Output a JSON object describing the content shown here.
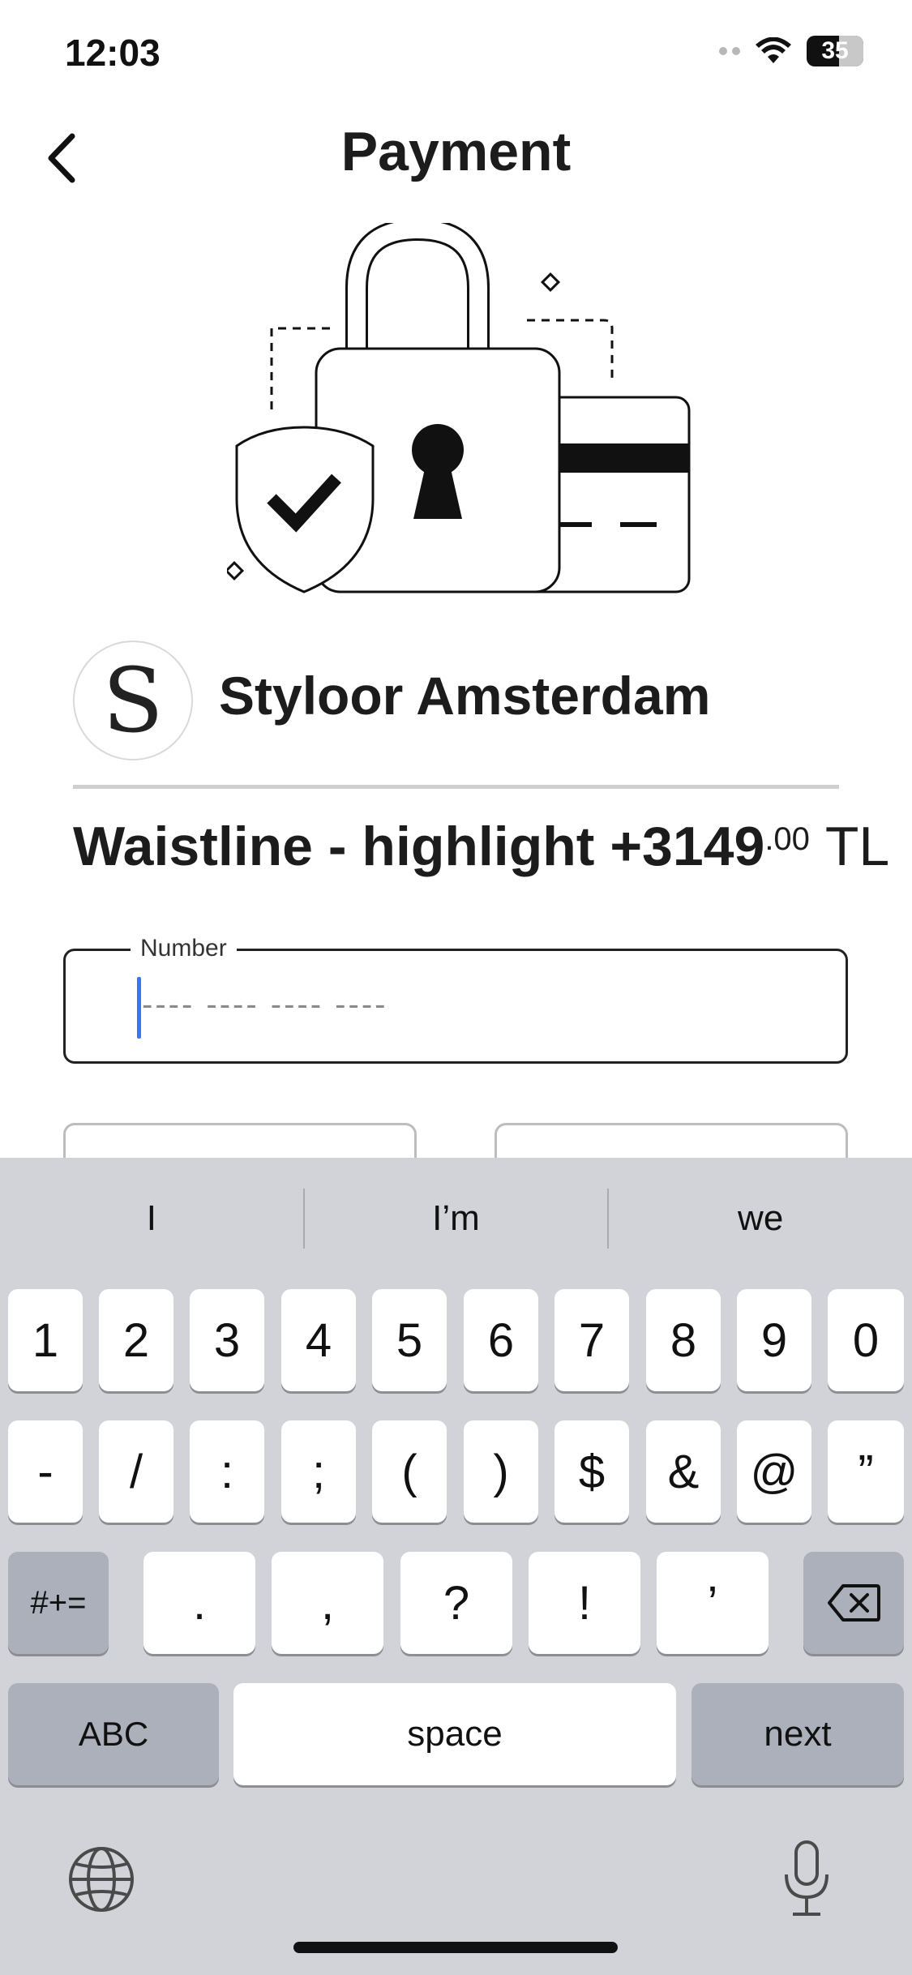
{
  "status_bar": {
    "time": "12:03",
    "battery": "35"
  },
  "header": {
    "title": "Payment"
  },
  "merchant": {
    "logo_letter": "S",
    "name": "Styloor Amsterdam"
  },
  "product": {
    "name": "Waistline - highlight",
    "price_whole": "+3149",
    "price_cents": ".00",
    "currency": "TL"
  },
  "card_form": {
    "number_label": "Number",
    "number_placeholder": "---- ---- ---- ----"
  },
  "keyboard": {
    "suggestions": [
      "I",
      "I’m",
      "we"
    ],
    "row1": [
      "1",
      "2",
      "3",
      "4",
      "5",
      "6",
      "7",
      "8",
      "9",
      "0"
    ],
    "row2": [
      "-",
      "/",
      ":",
      ";",
      "(",
      ")",
      "$",
      "&",
      "@",
      "”"
    ],
    "row3": [
      ".",
      ",",
      "?",
      "!",
      "’"
    ],
    "symbols_key": "#+=",
    "abc_key": "ABC",
    "space_key": "space",
    "next_key": "next"
  }
}
